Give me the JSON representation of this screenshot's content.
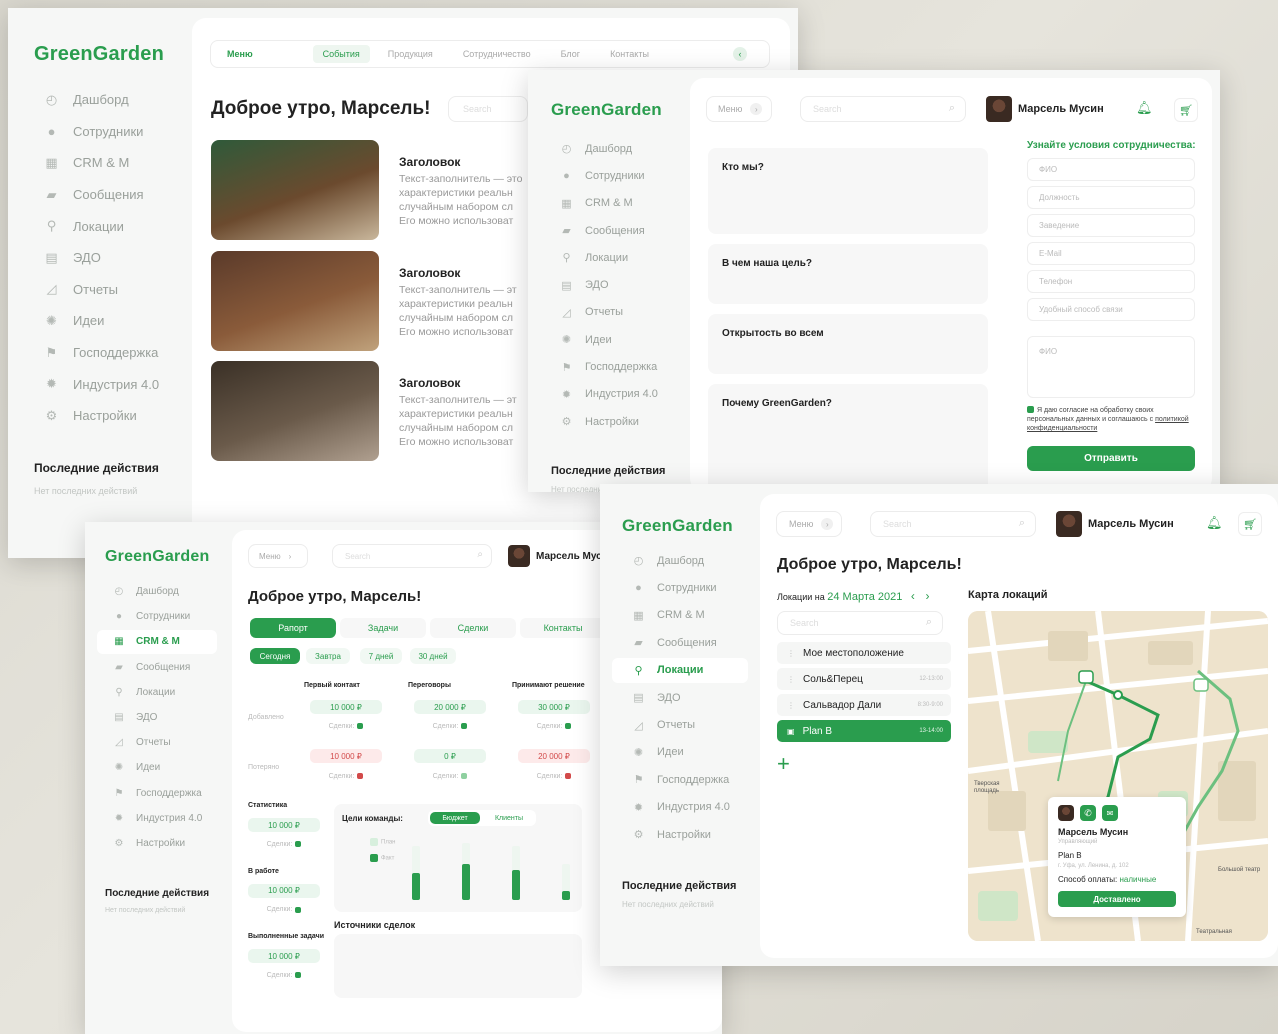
{
  "app": {
    "brand": "GreenGarden"
  },
  "sidebar": {
    "items": [
      {
        "label": "Дашборд",
        "icon": "dashboard-icon"
      },
      {
        "label": "Сотрудники",
        "icon": "people-icon"
      },
      {
        "label": "CRM & M",
        "icon": "grid-icon"
      },
      {
        "label": "Сообщения",
        "icon": "chat-icon"
      },
      {
        "label": "Локации",
        "icon": "pin-icon"
      },
      {
        "label": "ЭДО",
        "icon": "doc-icon"
      },
      {
        "label": "Отчеты",
        "icon": "chart-icon"
      },
      {
        "label": "Идеи",
        "icon": "bulb-icon"
      },
      {
        "label": "Господдержка",
        "icon": "flag-icon"
      },
      {
        "label": "Индустрия 4.0",
        "icon": "gear-cog-icon"
      },
      {
        "label": "Настройки",
        "icon": "settings-icon"
      }
    ],
    "recent_title": "Последние действия",
    "recent_empty": "Нет последних действий"
  },
  "header": {
    "menu": "Меню",
    "search_placeholder": "Search",
    "user_name": "Марсель Мусин"
  },
  "greeting": "Доброе утро, Марсель!",
  "screen1": {
    "tabs": [
      "Меню",
      "События",
      "Продукция",
      "Сотрудничество",
      "Блог",
      "Контакты"
    ],
    "articles": [
      {
        "title": "Заголовок",
        "text": "Текст-заполнитель — это характеристики реальн случайным набором сл Его можно использоват"
      },
      {
        "title": "Заголовок",
        "text": "Текст-заполнитель — эт характеристики реальн случайным набором сл Его можно использоват"
      },
      {
        "title": "Заголовок",
        "text": "Текст-заполнитель — эт характеристики реальн случайным набором сл Его можно использоват"
      }
    ]
  },
  "screen2": {
    "questions": [
      "Кто мы?",
      "В чем наша цель?",
      "Открытость во всем",
      "Почему GreenGarden?"
    ],
    "form_title": "Узнайте условия сотрудничества:",
    "fields": [
      "ФИО",
      "Должность",
      "Заведение",
      "E-Mail",
      "Телефон",
      "Удобный способ связи"
    ],
    "textarea": "ФИО",
    "consent": "Я даю согласие на обработку своих персональных данных и соглашаюсь с",
    "consent_link": "политикой конфиденциальности",
    "submit": "Отправить"
  },
  "screen3": {
    "tabs": [
      "Рапорт",
      "Задачи",
      "Сделки",
      "Контакты"
    ],
    "periods": [
      "Сегодня",
      "Завтра",
      "7 дней",
      "30 дней"
    ],
    "columns": [
      "Первый контакт",
      "Переговоры",
      "Принимают решение"
    ],
    "row_labels": [
      "Добавлено",
      "Потеряно"
    ],
    "added_values": [
      "10 000 ₽",
      "20 000 ₽",
      "30 000 ₽"
    ],
    "lost_values": [
      "10 000 ₽",
      "0 ₽",
      "20 000 ₽"
    ],
    "deals_label": "Сделки:",
    "stats_title": "Статистика",
    "in_work": "В работе",
    "done_tasks": "Выполненные задачи",
    "stat_values": [
      "10 000 ₽",
      "10 000 ₽",
      "10 000 ₽"
    ],
    "goals_title": "Цели команды:",
    "goal_tabs": [
      "Бюджет",
      "Клиенты"
    ],
    "legend": [
      "План",
      "Факт"
    ],
    "sources_title": "Источники сделок"
  },
  "screen4": {
    "locations_prefix": "Локации на",
    "date": "24 Марта 2021",
    "map_title": "Карта локаций",
    "locations": [
      {
        "name": "Мое местоположение",
        "time": ""
      },
      {
        "name": "Соль&Перец",
        "time": "12-13:00"
      },
      {
        "name": "Сальвадор Дали",
        "time": "8:30-9:00"
      },
      {
        "name": "Plan B",
        "time": "13-14:00"
      }
    ],
    "popup": {
      "name": "Марсель Мусин",
      "role": "Управляющий",
      "place": "Plan B",
      "address": "г. Уфа, ул. Ленина, д. 102",
      "pay_label": "Способ оплаты:",
      "pay_value": "наличные",
      "button": "Доставлено"
    },
    "map_labels": [
      "Театральная",
      "Тверская площадь",
      "Большой театр"
    ]
  },
  "colors": {
    "accent": "#2a9d4e",
    "danger": "#d24a4a"
  }
}
